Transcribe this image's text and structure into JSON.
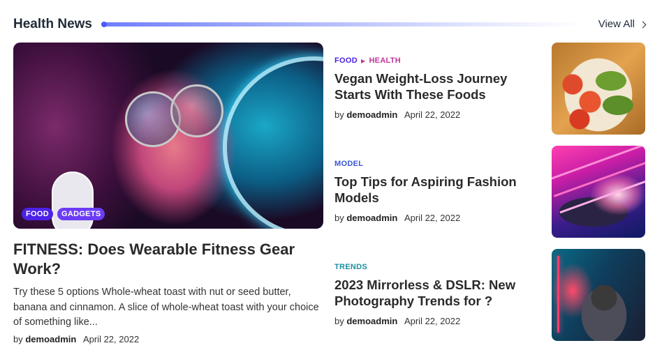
{
  "section": {
    "title": "Health News",
    "view_all": "View All"
  },
  "featured": {
    "tags": [
      "FOOD",
      "GADGETS"
    ],
    "title": "FITNESS: Does Wearable Fitness Gear Work?",
    "excerpt": "Try these 5 options Whole-wheat toast with nut or seed butter, banana and cinnamon. A slice of whole-wheat toast with your choice of something like...",
    "by": "by",
    "author": "demoadmin",
    "date": "April 22, 2022"
  },
  "posts": [
    {
      "categories": [
        {
          "label": "FOOD",
          "color": "#4b22e6"
        },
        {
          "label": "HEALTH",
          "color": "#c2369a"
        }
      ],
      "title": "Vegan Weight-Loss Journey Starts With These Foods",
      "by": "by",
      "author": "demoadmin",
      "date": "April 22, 2022",
      "thumb": "salad-photo"
    },
    {
      "categories": [
        {
          "label": "MODEL",
          "color": "#3a56d8"
        }
      ],
      "title": "Top Tips for Aspiring Fashion Models",
      "by": "by",
      "author": "demoadmin",
      "date": "April 22, 2022",
      "thumb": "fashion-model-photo"
    },
    {
      "categories": [
        {
          "label": "TRENDS",
          "color": "#1b8ea0"
        }
      ],
      "title": "2023 Mirrorless & DSLR: New Photography Trends for ?",
      "by": "by",
      "author": "demoadmin",
      "date": "April 22, 2022",
      "thumb": "photographer-photo"
    }
  ]
}
